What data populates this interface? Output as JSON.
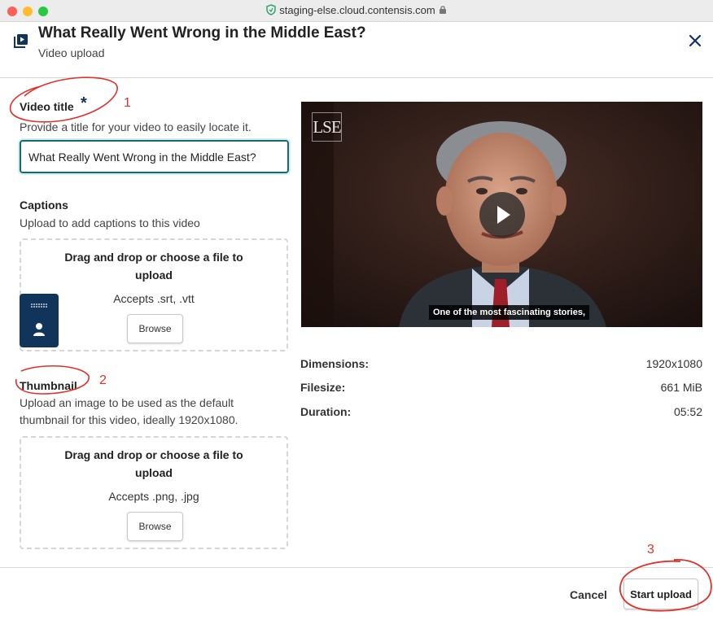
{
  "browser": {
    "url": "staging-else.cloud.contensis.com"
  },
  "header": {
    "title": "What Really Went Wrong in the Middle East?",
    "subtitle": "Video upload"
  },
  "video_title": {
    "label": "Video title",
    "required_mark": "*",
    "help": "Provide a title for your video to easily locate it.",
    "value": "What Really Went Wrong in the Middle East?"
  },
  "captions": {
    "label": "Captions",
    "help": "Upload to add captions to this video",
    "drop_text": "Drag and drop or choose a file to upload",
    "accepts": "Accepts .srt, .vtt",
    "browse_label": "Browse"
  },
  "thumbnail": {
    "label": "Thumbnail",
    "help": "Upload an image to be used as the default thumbnail for this video, ideally 1920x1080.",
    "drop_text": "Drag and drop or choose a file to upload",
    "accepts": "Accepts .png, .jpg",
    "browse_label": "Browse"
  },
  "preview": {
    "logo": "LSE",
    "caption": "One of the most fascinating stories,"
  },
  "meta": [
    {
      "key": "Dimensions:",
      "value": "1920x1080"
    },
    {
      "key": "Filesize:",
      "value": "661 MiB"
    },
    {
      "key": "Duration:",
      "value": "05:52"
    }
  ],
  "footer": {
    "cancel_label": "Cancel",
    "start_label": "Start upload"
  },
  "annotations": [
    "1",
    "2",
    "3"
  ],
  "colors": {
    "accent": "#116d73",
    "navy": "#10345a",
    "annotation": "#e0322a"
  },
  "icons": [
    "shield-icon",
    "lock-icon",
    "video-icon",
    "close-icon",
    "person-icon",
    "play-icon"
  ]
}
